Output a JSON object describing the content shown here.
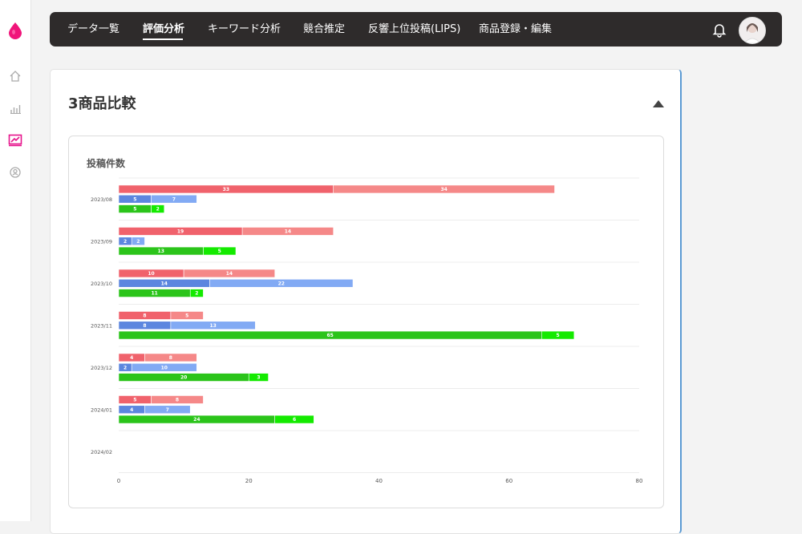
{
  "nav": {
    "items": [
      {
        "label": "データ一覧",
        "active": false
      },
      {
        "label": "評価分析",
        "active": true
      },
      {
        "label": "キーワード分析",
        "active": false
      },
      {
        "label": "競合推定",
        "active": false
      },
      {
        "label": "反響上位投稿(LIPS)",
        "active": false
      },
      {
        "label": "商品登録・編集",
        "active": false
      }
    ]
  },
  "sidebar": {
    "icons": [
      "drop-logo-icon",
      "home-icon",
      "bar-chart-icon",
      "chart-report-icon",
      "location-pin-icon"
    ],
    "active": "chart-report-icon"
  },
  "section": {
    "title": "3商品比較"
  },
  "chart_data": {
    "type": "bar",
    "orientation": "horizontal",
    "stacked": true,
    "title": "投稿件数",
    "categories": [
      "2023/08",
      "2023/09",
      "2023/10",
      "2023/11",
      "2023/12",
      "2024/01",
      "2024/02"
    ],
    "series": [
      {
        "color": "#f0626c",
        "values": [
          33,
          19,
          10,
          8,
          4,
          5,
          0
        ]
      },
      {
        "color": "#f58888",
        "values": [
          34,
          14,
          14,
          5,
          8,
          8,
          0
        ]
      },
      {
        "color": "#5c86df",
        "values": [
          5,
          2,
          14,
          8,
          2,
          4,
          0
        ]
      },
      {
        "color": "#82aaf4",
        "values": [
          7,
          2,
          22,
          13,
          10,
          7,
          0
        ]
      },
      {
        "color": "#2bc41a",
        "values": [
          5,
          13,
          11,
          65,
          20,
          24,
          0
        ]
      },
      {
        "color": "#14ea00",
        "values": [
          2,
          5,
          2,
          5,
          3,
          6,
          0
        ]
      }
    ],
    "groups": [
      [
        0,
        1
      ],
      [
        2,
        3
      ],
      [
        4,
        5
      ]
    ],
    "xlim": [
      0,
      80
    ],
    "xticks": [
      0,
      20,
      40,
      60,
      80
    ],
    "grid": true,
    "legend": "none"
  },
  "colors": {
    "nav_bg": "#2e2b2b",
    "brand_pink": "#f0147a",
    "card_accent": "#5b9ad3"
  }
}
